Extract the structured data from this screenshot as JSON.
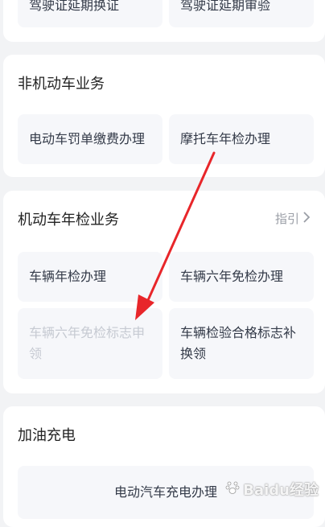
{
  "top_card": {
    "tiles": [
      "驾驶证延期换证",
      "驾驶证延期审验"
    ]
  },
  "non_motor_card": {
    "title": "非机动车业务",
    "tiles": [
      "电动车罚单缴费办理",
      "摩托车年检办理"
    ]
  },
  "inspection_card": {
    "title": "机动车年检业务",
    "guide_label": "指引",
    "tiles": [
      "车辆年检办理",
      "车辆六年免检办理",
      "车辆六年免检标志申领",
      "车辆检验合格标志补换领"
    ]
  },
  "fuel_card": {
    "title": "加油充电",
    "tiles": [
      "电动汽车充电办理"
    ]
  },
  "watermark": {
    "text": "Baidu经验"
  },
  "colors": {
    "annotation_arrow": "#e8262a",
    "disabled_text": "#c6cad2"
  }
}
